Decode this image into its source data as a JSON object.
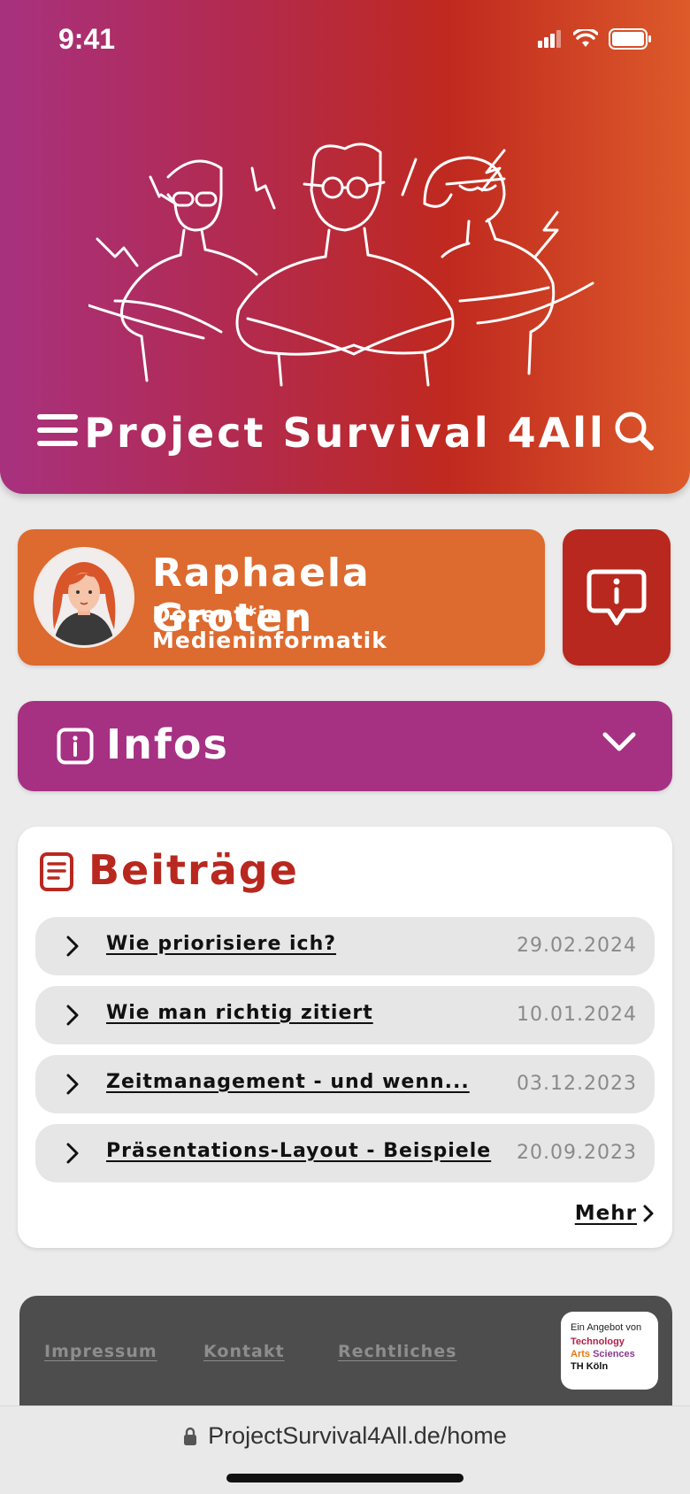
{
  "status_bar": {
    "time": "9:41"
  },
  "header": {
    "title": "Project Survival 4All"
  },
  "profile": {
    "name": "Raphaela Groten",
    "role": "Dozent*in - Medieninformatik"
  },
  "infos": {
    "label": "Infos"
  },
  "posts": {
    "title": "Beiträge",
    "items": [
      {
        "title": "Wie priorisiere ich?",
        "date": "29.02.2024"
      },
      {
        "title": "Wie man richtig zitiert",
        "date": "10.01.2024"
      },
      {
        "title": "Zeitmanagement - und wenn...",
        "date": "03.12.2023"
      },
      {
        "title": "Präsentations-Layout - Beispiele",
        "date": "20.09.2023"
      }
    ],
    "more_label": "Mehr"
  },
  "footer": {
    "links": [
      "Impressum",
      "Kontakt",
      "Rechtliches"
    ],
    "logo": {
      "line1": "Ein Angebot von",
      "line2": "Technology",
      "line3a": "Arts",
      "line3b": "Sciences",
      "line4": "TH Köln"
    }
  },
  "browser": {
    "url": "ProjectSurvival4All.de/home"
  },
  "colors": {
    "header_gradient_start": "#a8317f",
    "header_gradient_end": "#dd5a2a",
    "profile_orange": "#dd6a2e",
    "info_red": "#b8281f",
    "infos_purple": "#a63183",
    "posts_title_red": "#b8281f",
    "footer_gray": "#4d4d4d"
  },
  "icons": {
    "menu": "hamburger-icon",
    "search": "search-icon",
    "info": "info-bubble-icon",
    "infos": "info-square-icon",
    "chevron": "chevron-down-icon",
    "posts": "document-icon",
    "row": "chevron-right-icon",
    "lock": "lock-icon"
  }
}
